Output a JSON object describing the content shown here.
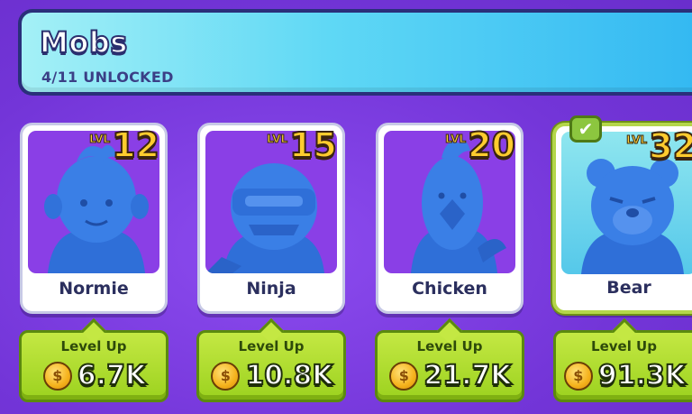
{
  "header": {
    "title": "Mobs",
    "subtitle": "4/11 UNLOCKED"
  },
  "mobs": [
    {
      "name": "Normie",
      "lvl_tag": "LVL",
      "level": "12",
      "action": "Level Up",
      "cost": "6.7K",
      "icon": "normie-mob",
      "selected": false
    },
    {
      "name": "Ninja",
      "lvl_tag": "LVL",
      "level": "15",
      "action": "Level Up",
      "cost": "10.8K",
      "icon": "ninja-mob",
      "selected": false
    },
    {
      "name": "Chicken",
      "lvl_tag": "LVL",
      "level": "20",
      "action": "Level Up",
      "cost": "21.7K",
      "icon": "chicken-mob",
      "selected": false
    },
    {
      "name": "Bear",
      "lvl_tag": "LVL",
      "level": "32",
      "action": "Level Up",
      "cost": "91.3K",
      "icon": "bear-mob",
      "selected": true
    }
  ],
  "colors": {
    "background": "#7b3fe0",
    "header_gradient_start": "#a4f0f6",
    "header_gradient_end": "#33b8f2",
    "mob_figure": "#2f6fd8",
    "level_gold": "#ffcc2e",
    "level_up_green": "#9cd21f",
    "selected_border": "#b4d64a"
  },
  "icons": {
    "coin": "coin-icon",
    "check": "check-icon"
  }
}
